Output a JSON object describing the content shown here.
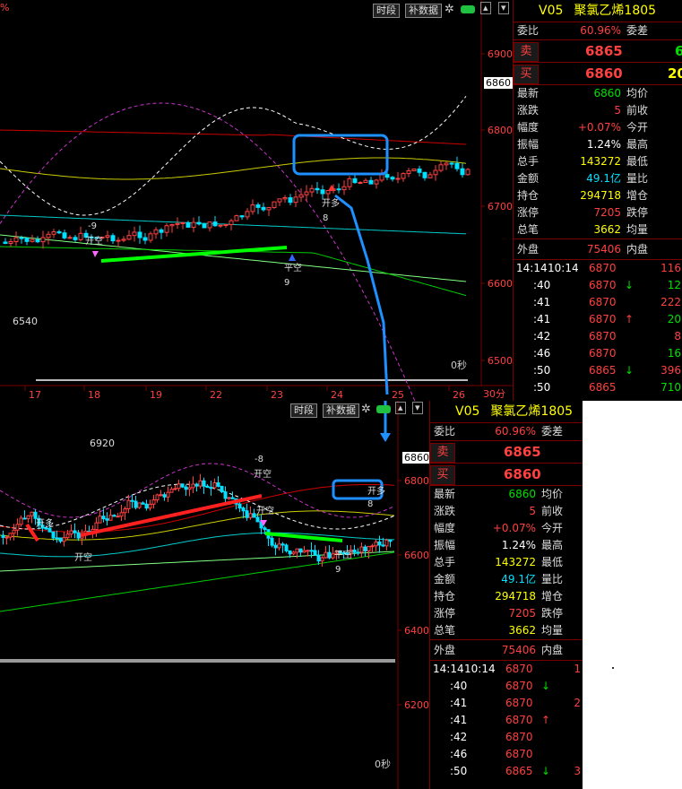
{
  "top": {
    "toolbar": {
      "time_label": "时段",
      "fill_label": "补数据"
    },
    "pct_glyph": "%",
    "price_axis": [
      "6900",
      "6800",
      "6700",
      "6600",
      "6500"
    ],
    "current_price": "6860",
    "date_axis": [
      "17",
      "18",
      "19",
      "22",
      "23",
      "24",
      "25",
      "26"
    ],
    "period_label": "30分",
    "seconds_label": "0秒",
    "annotations": {
      "low": "6540",
      "kaikong": "开空",
      "kaikong_num": "-9",
      "pingkong": "平空",
      "pingkong_num": "9",
      "kaiduo": "开多",
      "kaiduo_num": "8"
    },
    "quote": {
      "code": "V05",
      "name": "聚氯乙烯1805",
      "weibi_label": "委比",
      "weibi": "60.96%",
      "weicha_label": "委差",
      "sell_label": "卖",
      "sell_price": "6865",
      "sell_vol": "6",
      "buy_label": "买",
      "buy_price": "6860",
      "buy_vol": "20",
      "rows": [
        {
          "l": "最新",
          "v": "6860",
          "c": "green",
          "l2": "均价"
        },
        {
          "l": "涨跌",
          "v": "5",
          "c": "red",
          "l2": "前收"
        },
        {
          "l": "幅度",
          "v": "+0.07%",
          "c": "red",
          "l2": "今开"
        },
        {
          "l": "振幅",
          "v": "1.24%",
          "c": "white",
          "l2": "最高"
        },
        {
          "l": "总手",
          "v": "143272",
          "c": "yellow",
          "l2": "最低"
        },
        {
          "l": "金额",
          "v": "49.1亿",
          "c": "cyan",
          "l2": "量比"
        },
        {
          "l": "持仓",
          "v": "294718",
          "c": "yellow",
          "l2": "增仓"
        },
        {
          "l": "涨停",
          "v": "7205",
          "c": "red",
          "l2": "跌停"
        },
        {
          "l": "总笔",
          "v": "3662",
          "c": "yellow",
          "l2": "均量"
        }
      ],
      "outer_label": "外盘",
      "outer": "75406",
      "inner_label": "内盘",
      "ticks": [
        {
          "t": "14:14",
          "t2": "10:14",
          "p": "6870",
          "arrow": "",
          "v": "116"
        },
        {
          "t": ":40",
          "t2": "",
          "p": "6870",
          "arrow": "↓",
          "v": "12"
        },
        {
          "t": ":41",
          "t2": "",
          "p": "6870",
          "arrow": "",
          "v": "222"
        },
        {
          "t": ":41",
          "t2": "",
          "p": "6870",
          "arrow": "↑",
          "v": "20"
        },
        {
          "t": ":42",
          "t2": "",
          "p": "6870",
          "arrow": "",
          "v": "8"
        },
        {
          "t": ":46",
          "t2": "",
          "p": "6870",
          "arrow": "",
          "v": "16"
        },
        {
          "t": ":50",
          "t2": "",
          "p": "6865",
          "arrow": "↓",
          "v": "396"
        },
        {
          "t": ":50",
          "t2": "",
          "p": "6865",
          "arrow": "",
          "v": "710"
        }
      ]
    }
  },
  "bottom": {
    "toolbar": {
      "time_label": "时段",
      "fill_label": "补数据"
    },
    "price_axis": [
      "6800",
      "6600",
      "6400",
      "6200"
    ],
    "current_price": "6860",
    "seconds_label": "0秒",
    "annotations": {
      "high": "6920",
      "kaiduo": "开多",
      "kaikong": "开空",
      "pingkong": "平空",
      "num8": "8",
      "num9": "9",
      "num_m8": "-8",
      "kaiduo2": "开多"
    },
    "quote": {
      "code": "V05",
      "name": "聚氯乙烯1805",
      "weibi_label": "委比",
      "weibi": "60.96%",
      "weicha_label": "委差",
      "sell_label": "卖",
      "sell_price": "6865",
      "buy_label": "买",
      "buy_price": "6860",
      "rows": [
        {
          "l": "最新",
          "v": "6860",
          "c": "green",
          "l2": "均价"
        },
        {
          "l": "涨跌",
          "v": "5",
          "c": "red",
          "l2": "前收"
        },
        {
          "l": "幅度",
          "v": "+0.07%",
          "c": "red",
          "l2": "今开"
        },
        {
          "l": "振幅",
          "v": "1.24%",
          "c": "white",
          "l2": "最高"
        },
        {
          "l": "总手",
          "v": "143272",
          "c": "yellow",
          "l2": "最低"
        },
        {
          "l": "金额",
          "v": "49.1亿",
          "c": "cyan",
          "l2": "量比"
        },
        {
          "l": "持仓",
          "v": "294718",
          "c": "yellow",
          "l2": "增仓"
        },
        {
          "l": "涨停",
          "v": "7205",
          "c": "red",
          "l2": "跌停"
        },
        {
          "l": "总笔",
          "v": "3662",
          "c": "yellow",
          "l2": "均量"
        }
      ],
      "outer_label": "外盘",
      "outer": "75406",
      "inner_label": "内盘",
      "ticks": [
        {
          "t": "14:14",
          "t2": "10:14",
          "p": "6870",
          "arrow": "",
          "v": "1"
        },
        {
          "t": ":40",
          "t2": "",
          "p": "6870",
          "arrow": "↓",
          "v": ""
        },
        {
          "t": ":41",
          "t2": "",
          "p": "6870",
          "arrow": "",
          "v": "2"
        },
        {
          "t": ":41",
          "t2": "",
          "p": "6870",
          "arrow": "↑",
          "v": ""
        },
        {
          "t": ":42",
          "t2": "",
          "p": "6870",
          "arrow": "",
          "v": ""
        },
        {
          "t": ":46",
          "t2": "",
          "p": "6870",
          "arrow": "",
          "v": ""
        },
        {
          "t": ":50",
          "t2": "",
          "p": "6865",
          "arrow": "↓",
          "v": "3"
        }
      ]
    }
  },
  "colors": {
    "up": "#ff4040",
    "down": "#00e0ff",
    "green_line": "#00ff00",
    "annotation_blue": "#1e90ff"
  }
}
